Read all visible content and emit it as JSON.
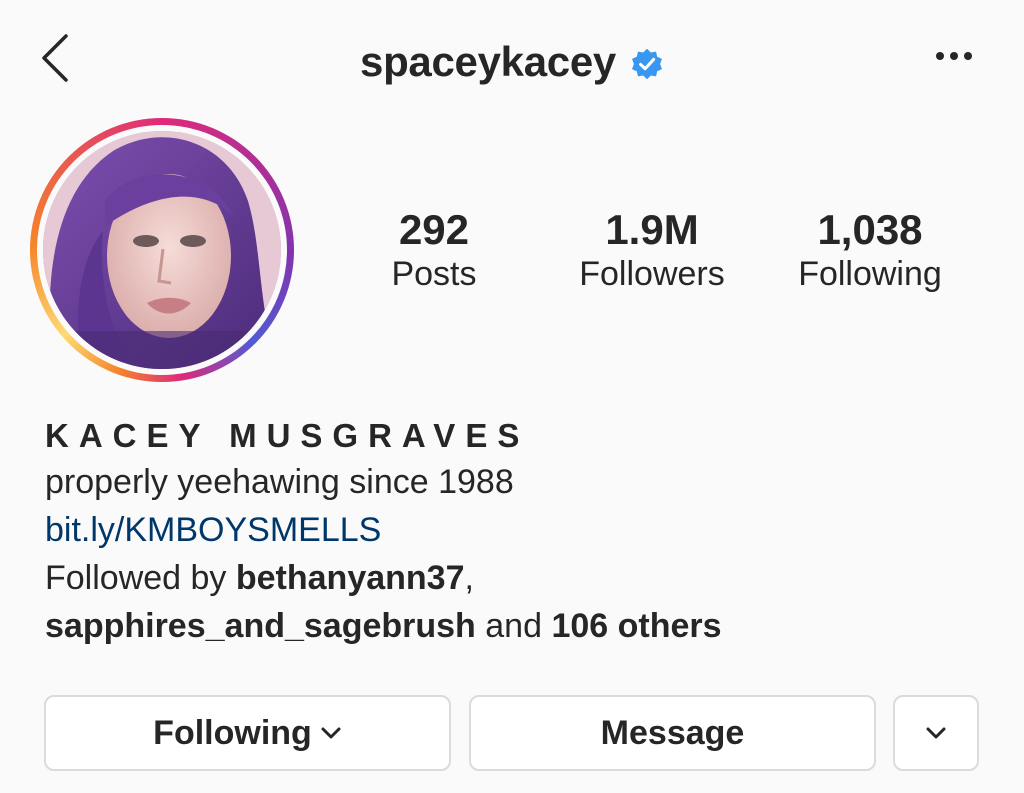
{
  "header": {
    "username": "spaceykacey",
    "verified": true,
    "icons": {
      "back": "chevron-left-icon",
      "verified": "verified-badge-icon",
      "more": "more-horizontal-icon"
    },
    "verified_color": "#3897f0"
  },
  "stats": {
    "posts": {
      "value": "292",
      "label": "Posts"
    },
    "followers": {
      "value": "1.9M",
      "label": "Followers"
    },
    "following": {
      "value": "1,038",
      "label": "Following"
    }
  },
  "bio": {
    "full_name": "KACEY MUSGRAVES",
    "tagline": "properly yeehawing since 1988",
    "link": "bit.ly/KMBOYSMELLS",
    "followed_by": {
      "prefix": "Followed by ",
      "user1": "bethanyann37",
      "sep": ",",
      "user2": "sapphires_and_sagebrush",
      "and": " and ",
      "others": "106 others"
    }
  },
  "actions": {
    "following_label": "Following",
    "message_label": "Message",
    "icons": {
      "following_dropdown": "chevron-down-icon",
      "suggestions": "chevron-down-icon"
    }
  },
  "colors": {
    "link": "#00376b",
    "text": "#262626",
    "button_border": "#dbdbdb",
    "background": "#fafafa"
  }
}
